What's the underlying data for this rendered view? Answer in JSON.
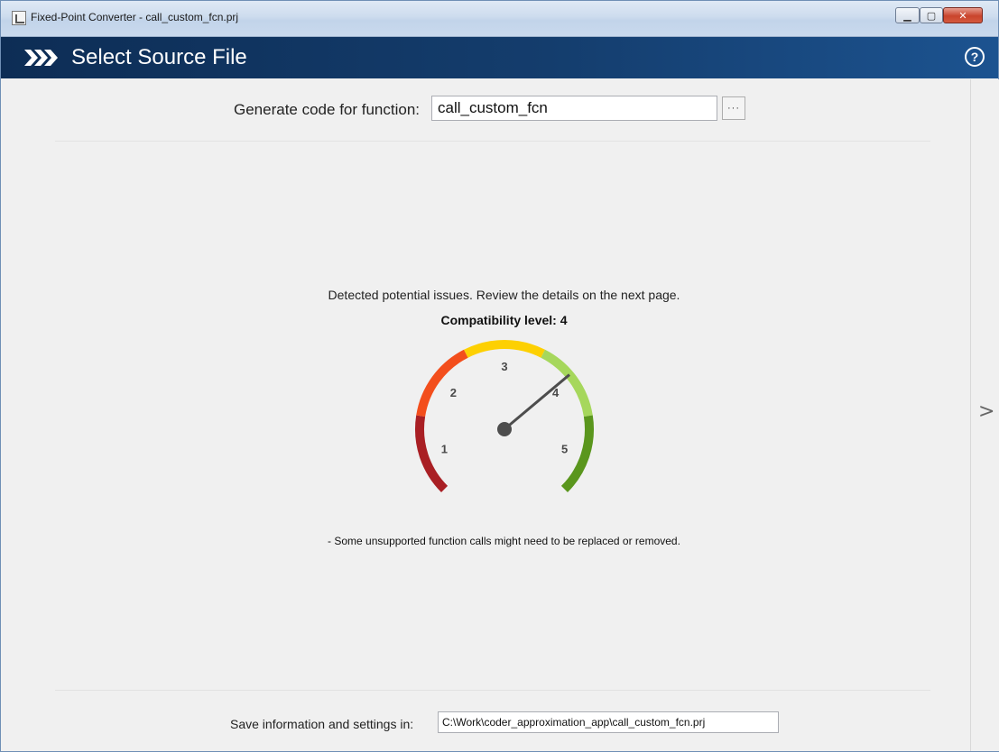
{
  "window": {
    "title": "Fixed-Point Converter - call_custom_fcn.prj",
    "minimize_label": "▁",
    "maximize_label": "▢",
    "close_label": "✕"
  },
  "header": {
    "title": "Select Source File",
    "help_label": "?"
  },
  "function_row": {
    "label": "Generate code for function:",
    "value": "call_custom_fcn",
    "browse_label": "···"
  },
  "status": {
    "message": "Detected potential issues. Review the details on the next page.",
    "compatibility_label": "Compatibility level: 4",
    "note": "- Some unsupported function calls might need to be replaced or removed."
  },
  "gauge": {
    "level": 4,
    "max_level": 5,
    "tick_labels": [
      "1",
      "2",
      "3",
      "4",
      "5"
    ],
    "segment_colors": [
      "#a91f24",
      "#f34e1c",
      "#fdd002",
      "#a6d75c",
      "#5a961d"
    ],
    "needle_color": "#4d4d4d"
  },
  "settings_row": {
    "label": "Save information and settings in:",
    "value": "C:\\Work\\coder_approximation_app\\call_custom_fcn.prj"
  },
  "nav": {
    "next_label": ">"
  },
  "colors": {
    "header_bg": "#123a68",
    "panel_bg": "#f0f0f0"
  }
}
